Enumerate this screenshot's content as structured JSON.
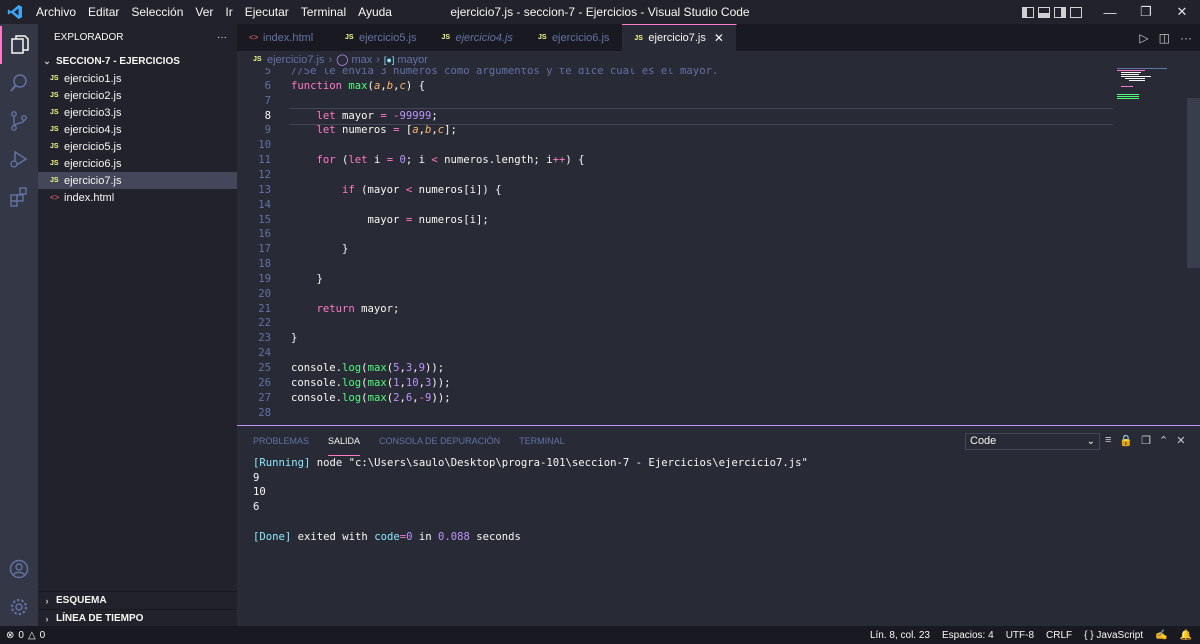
{
  "window": {
    "title": "ejercicio7.js - seccion-7 - Ejercicios - Visual Studio Code",
    "menu": [
      "Archivo",
      "Editar",
      "Selección",
      "Ver",
      "Ir",
      "Ejecutar",
      "Terminal",
      "Ayuda"
    ]
  },
  "sidebar": {
    "title": "EXPLORADOR",
    "more": "···",
    "folder": "SECCION-7 - EJERCICIOS",
    "files": [
      {
        "name": "ejercicio1.js",
        "type": "js"
      },
      {
        "name": "ejercicio2.js",
        "type": "js"
      },
      {
        "name": "ejercicio3.js",
        "type": "js"
      },
      {
        "name": "ejercicio4.js",
        "type": "js"
      },
      {
        "name": "ejercicio5.js",
        "type": "js"
      },
      {
        "name": "ejercicio6.js",
        "type": "js"
      },
      {
        "name": "ejercicio7.js",
        "type": "js"
      },
      {
        "name": "index.html",
        "type": "html"
      }
    ],
    "active_file": "ejercicio7.js",
    "outline": "ESQUEMA",
    "timeline": "LÍNEA DE TIEMPO"
  },
  "tabs": [
    {
      "label": "index.html",
      "icon": "html-icon",
      "active": false,
      "italic": false
    },
    {
      "label": "ejercicio5.js",
      "icon": "js-icon",
      "active": false,
      "italic": false
    },
    {
      "label": "ejercicio4.js",
      "icon": "js-icon",
      "active": false,
      "italic": true
    },
    {
      "label": "ejercicio6.js",
      "icon": "js-icon",
      "active": false,
      "italic": false
    },
    {
      "label": "ejercicio7.js",
      "icon": "js-icon",
      "active": true,
      "italic": false
    }
  ],
  "breadcrumb": {
    "file": "ejercicio7.js",
    "func": "max",
    "var": "mayor"
  },
  "editor": {
    "current_line": 8,
    "lines": [
      {
        "n": 5,
        "tokens": [
          [
            "cm",
            "//Se le envia 3 numeros como argumentos y te dice cual es el mayor."
          ]
        ]
      },
      {
        "n": 6,
        "tokens": [
          [
            "kw",
            "function "
          ],
          [
            "fn",
            "max"
          ],
          [
            "pl",
            "("
          ],
          [
            "pm",
            "a"
          ],
          [
            "pl",
            ","
          ],
          [
            "pm",
            "b"
          ],
          [
            "pl",
            ","
          ],
          [
            "pm",
            "c"
          ],
          [
            "pl",
            ") {"
          ]
        ]
      },
      {
        "n": 7,
        "tokens": []
      },
      {
        "n": 8,
        "tokens": [
          [
            "pl",
            "    "
          ],
          [
            "kw",
            "let "
          ],
          [
            "pl",
            "mayor "
          ],
          [
            "op",
            "= "
          ],
          [
            "op",
            "-"
          ],
          [
            "num",
            "99999"
          ],
          [
            "pl",
            ";"
          ]
        ]
      },
      {
        "n": 9,
        "tokens": [
          [
            "pl",
            "    "
          ],
          [
            "kw",
            "let "
          ],
          [
            "pl",
            "numeros "
          ],
          [
            "op",
            "= "
          ],
          [
            "pl",
            "["
          ],
          [
            "pm",
            "a"
          ],
          [
            "pl",
            ","
          ],
          [
            "pm",
            "b"
          ],
          [
            "pl",
            ","
          ],
          [
            "pm",
            "c"
          ],
          [
            "pl",
            "];"
          ]
        ]
      },
      {
        "n": 10,
        "tokens": []
      },
      {
        "n": 11,
        "tokens": [
          [
            "pl",
            "    "
          ],
          [
            "kw",
            "for "
          ],
          [
            "pl",
            "("
          ],
          [
            "kw",
            "let "
          ],
          [
            "pl",
            "i "
          ],
          [
            "op",
            "= "
          ],
          [
            "num",
            "0"
          ],
          [
            "pl",
            "; i "
          ],
          [
            "op",
            "< "
          ],
          [
            "pl",
            "numeros.length; i"
          ],
          [
            "op",
            "++"
          ],
          [
            "pl",
            ") {"
          ]
        ]
      },
      {
        "n": 12,
        "tokens": []
      },
      {
        "n": 13,
        "tokens": [
          [
            "pl",
            "        "
          ],
          [
            "kw",
            "if "
          ],
          [
            "pl",
            "(mayor "
          ],
          [
            "op",
            "< "
          ],
          [
            "pl",
            "numeros[i]) {"
          ]
        ]
      },
      {
        "n": 14,
        "tokens": []
      },
      {
        "n": 15,
        "tokens": [
          [
            "pl",
            "            mayor "
          ],
          [
            "op",
            "= "
          ],
          [
            "pl",
            "numeros[i];"
          ]
        ]
      },
      {
        "n": 16,
        "tokens": []
      },
      {
        "n": 17,
        "tokens": [
          [
            "pl",
            "        }"
          ]
        ]
      },
      {
        "n": 18,
        "tokens": []
      },
      {
        "n": 19,
        "tokens": [
          [
            "pl",
            "    }"
          ]
        ]
      },
      {
        "n": 20,
        "tokens": []
      },
      {
        "n": 21,
        "tokens": [
          [
            "pl",
            "    "
          ],
          [
            "kw",
            "return "
          ],
          [
            "pl",
            "mayor;"
          ]
        ]
      },
      {
        "n": 22,
        "tokens": []
      },
      {
        "n": 23,
        "tokens": [
          [
            "pl",
            "}"
          ]
        ]
      },
      {
        "n": 24,
        "tokens": []
      },
      {
        "n": 25,
        "tokens": [
          [
            "pl",
            "console."
          ],
          [
            "fn",
            "log"
          ],
          [
            "pl",
            "("
          ],
          [
            "fn",
            "max"
          ],
          [
            "pl",
            "("
          ],
          [
            "num",
            "5"
          ],
          [
            "pl",
            ","
          ],
          [
            "num",
            "3"
          ],
          [
            "pl",
            ","
          ],
          [
            "num",
            "9"
          ],
          [
            "pl",
            "));"
          ]
        ]
      },
      {
        "n": 26,
        "tokens": [
          [
            "pl",
            "console."
          ],
          [
            "fn",
            "log"
          ],
          [
            "pl",
            "("
          ],
          [
            "fn",
            "max"
          ],
          [
            "pl",
            "("
          ],
          [
            "num",
            "1"
          ],
          [
            "pl",
            ","
          ],
          [
            "num",
            "10"
          ],
          [
            "pl",
            ","
          ],
          [
            "num",
            "3"
          ],
          [
            "pl",
            "));"
          ]
        ]
      },
      {
        "n": 27,
        "tokens": [
          [
            "pl",
            "console."
          ],
          [
            "fn",
            "log"
          ],
          [
            "pl",
            "("
          ],
          [
            "fn",
            "max"
          ],
          [
            "pl",
            "("
          ],
          [
            "num",
            "2"
          ],
          [
            "pl",
            ","
          ],
          [
            "num",
            "6"
          ],
          [
            "pl",
            ","
          ],
          [
            "op",
            "-"
          ],
          [
            "num",
            "9"
          ],
          [
            "pl",
            "));"
          ]
        ]
      },
      {
        "n": 28,
        "tokens": []
      }
    ]
  },
  "panel": {
    "tabs": [
      "PROBLEMAS",
      "SALIDA",
      "CONSOLA DE DEPURACIÓN",
      "TERMINAL"
    ],
    "active_tab": "SALIDA",
    "output_channel": "Code",
    "output": [
      {
        "tokens": [
          [
            "bl",
            "[Running] "
          ],
          [
            "pl",
            "node \"c:\\Users\\saulo\\Desktop\\progra-101\\seccion-7 - Ejercicios\\ejercicio7.js\""
          ]
        ]
      },
      {
        "tokens": [
          [
            "pl",
            "9"
          ]
        ]
      },
      {
        "tokens": [
          [
            "pl",
            "10"
          ]
        ]
      },
      {
        "tokens": [
          [
            "pl",
            "6"
          ]
        ]
      },
      {
        "tokens": []
      },
      {
        "tokens": [
          [
            "bl",
            "[Done] "
          ],
          [
            "pl",
            "exited with "
          ],
          [
            "bl",
            "code"
          ],
          [
            "op",
            "="
          ],
          [
            "num",
            "0"
          ],
          [
            "pl",
            " in "
          ],
          [
            "num",
            "0.088"
          ],
          [
            "pl",
            " seconds"
          ]
        ]
      }
    ]
  },
  "statusbar": {
    "errors": "0",
    "warnings": "0",
    "position": "Lín. 8, col. 23",
    "spaces": "Espacios: 4",
    "encoding": "UTF-8",
    "eol": "CRLF",
    "language": "JavaScript"
  },
  "colors": {
    "background": "#282a36",
    "accent": "#ff79c6",
    "keyword": "#ff79c6",
    "function": "#50fa7b",
    "parameter": "#ffb86c",
    "number": "#bd93f9",
    "comment": "#6272a4"
  }
}
